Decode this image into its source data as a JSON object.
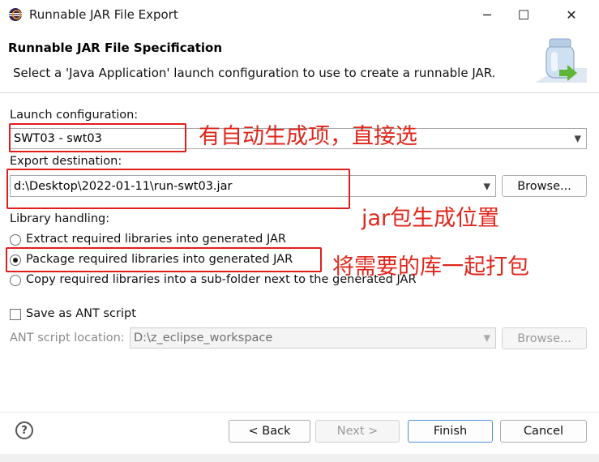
{
  "window": {
    "title": "Runnable JAR File Export",
    "minimize_glyph": "─",
    "maximize_glyph": "☐",
    "close_glyph": "✕"
  },
  "header": {
    "title": "Runnable JAR File Specification",
    "description": "Select a 'Java Application' launch configuration to use to create a runnable JAR."
  },
  "launch": {
    "label": "Launch configuration:",
    "value": "SWT03 - swt03"
  },
  "export": {
    "label": "Export destination:",
    "value": "d:\\Desktop\\2022-01-11\\run-swt03.jar",
    "browse_label": "Browse..."
  },
  "library": {
    "label": "Library handling:",
    "options": [
      {
        "label": "Extract required libraries into generated JAR",
        "checked": false
      },
      {
        "label": "Package required libraries into generated JAR",
        "checked": true
      },
      {
        "label": "Copy required libraries into a sub-folder next to the generated JAR",
        "checked": false
      }
    ]
  },
  "ant": {
    "save_label": "Save as ANT script",
    "save_checked": false,
    "location_label": "ANT script location:",
    "location_value": "D:\\z_eclipse_workspace",
    "browse_label": "Browse..."
  },
  "buttons": {
    "help_glyph": "?",
    "back": "< Back",
    "next": "Next >",
    "finish": "Finish",
    "cancel": "Cancel"
  },
  "annotations": {
    "launch": "有自动生成项，直接选",
    "export": "jar包生成位置",
    "package": "将需要的库一起打包"
  },
  "colors": {
    "annotation_red": "#e0261c",
    "default_button_border": "#4a90d9"
  }
}
